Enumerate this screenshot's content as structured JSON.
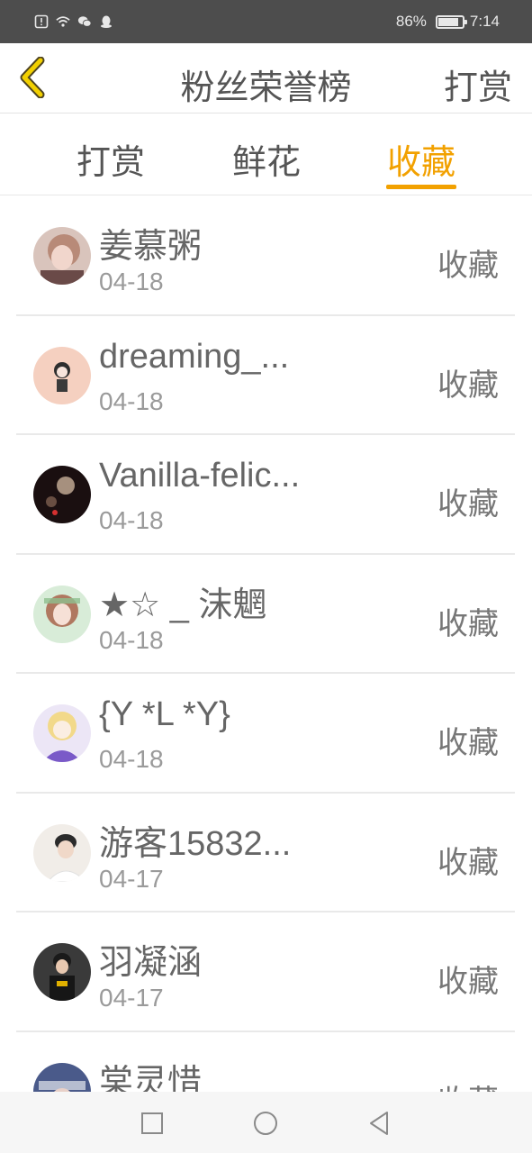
{
  "status_bar": {
    "battery_text": "86%",
    "battery_level": 0.86,
    "time": "7:14",
    "icons": [
      "alert-icon",
      "wifi-icon",
      "wechat-icon",
      "qq-icon"
    ]
  },
  "header": {
    "back_icon": "chevron-left-icon",
    "title": "粉丝荣誉榜",
    "action_label": "打赏"
  },
  "tabs": [
    {
      "label": "打赏",
      "active": false
    },
    {
      "label": "鲜花",
      "active": false
    },
    {
      "label": "收藏",
      "active": true
    }
  ],
  "colors": {
    "accent": "#f2a100",
    "status_bar_bg": "#4d4d4d",
    "text": "#555555",
    "muted": "#9a9a9a"
  },
  "list": [
    {
      "name": "姜慕粥",
      "date": "04-18",
      "type": "收藏"
    },
    {
      "name": "dreaming_...",
      "date": "04-18",
      "type": "收藏"
    },
    {
      "name": "Vanilla-felic...",
      "date": "04-18",
      "type": "收藏"
    },
    {
      "name": "★☆ _ 沫魍",
      "date": "04-18",
      "type": "收藏"
    },
    {
      "name": "{Y *L *Y}",
      "date": "04-18",
      "type": "收藏"
    },
    {
      "name": "游客15832...",
      "date": "04-17",
      "type": "收藏"
    },
    {
      "name": "羽凝涵",
      "date": "04-17",
      "type": "收藏"
    },
    {
      "name": "棠灵惜",
      "date": "",
      "type": "收藏"
    }
  ],
  "system_nav": [
    "square-icon",
    "circle-icon",
    "back-triangle-icon"
  ]
}
